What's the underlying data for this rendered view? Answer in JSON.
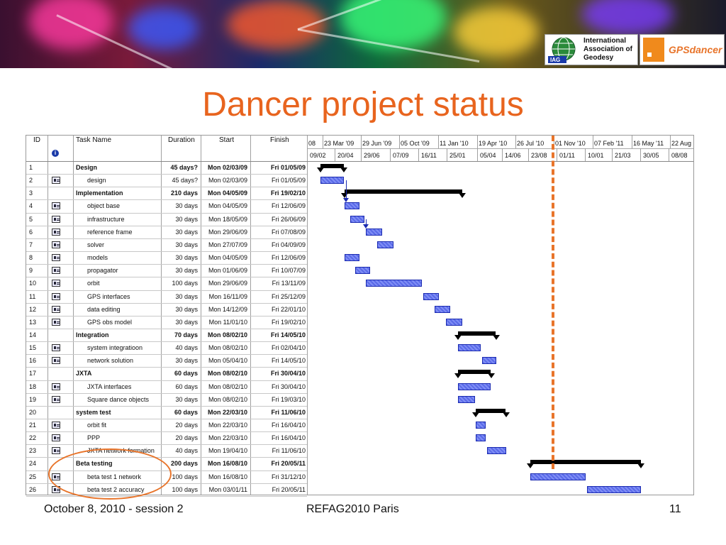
{
  "banner": {
    "iag_logo_text": "International Association of Geodesy",
    "iag_abbr": "IAG",
    "gps_logo_text": "GPSdancer"
  },
  "title": "Dancer project status",
  "gantt": {
    "headers": {
      "id": "ID",
      "task": "Task Name",
      "duration": "Duration",
      "start": "Start",
      "finish": "Finish"
    },
    "timescale_top": [
      "08",
      "23 Mar '09",
      "29 Jun '09",
      "05 Oct '09",
      "11 Jan '10",
      "19 Apr '10",
      "26 Jul '10",
      "01 Nov '10",
      "07 Feb '11",
      "16 May '11",
      "22 Aug"
    ],
    "timescale_bottom": [
      "09/02",
      "20/04",
      "29/06",
      "07/09",
      "16/11",
      "25/01",
      "05/04",
      "14/06",
      "23/08",
      "01/11",
      "10/01",
      "21/03",
      "30/05",
      "08/08"
    ],
    "tasks": [
      {
        "id": "1",
        "name": "Design",
        "duration": "45 days?",
        "start": "Mon 02/03/09",
        "finish": "Fri 01/05/09",
        "summary": true,
        "indent": 0
      },
      {
        "id": "2",
        "name": "design",
        "duration": "45 days?",
        "start": "Mon 02/03/09",
        "finish": "Fri 01/05/09",
        "summary": false,
        "indent": 1
      },
      {
        "id": "3",
        "name": "Implementation",
        "duration": "210 days",
        "start": "Mon 04/05/09",
        "finish": "Fri 19/02/10",
        "summary": true,
        "indent": 0
      },
      {
        "id": "4",
        "name": "object base",
        "duration": "30 days",
        "start": "Mon 04/05/09",
        "finish": "Fri 12/06/09",
        "summary": false,
        "indent": 1
      },
      {
        "id": "5",
        "name": "infrastructure",
        "duration": "30 days",
        "start": "Mon 18/05/09",
        "finish": "Fri 26/06/09",
        "summary": false,
        "indent": 1
      },
      {
        "id": "6",
        "name": "reference frame",
        "duration": "30 days",
        "start": "Mon 29/06/09",
        "finish": "Fri 07/08/09",
        "summary": false,
        "indent": 1
      },
      {
        "id": "7",
        "name": "solver",
        "duration": "30 days",
        "start": "Mon 27/07/09",
        "finish": "Fri 04/09/09",
        "summary": false,
        "indent": 1
      },
      {
        "id": "8",
        "name": "models",
        "duration": "30 days",
        "start": "Mon 04/05/09",
        "finish": "Fri 12/06/09",
        "summary": false,
        "indent": 1
      },
      {
        "id": "9",
        "name": "propagator",
        "duration": "30 days",
        "start": "Mon 01/06/09",
        "finish": "Fri 10/07/09",
        "summary": false,
        "indent": 1
      },
      {
        "id": "10",
        "name": "orbit",
        "duration": "100 days",
        "start": "Mon 29/06/09",
        "finish": "Fri 13/11/09",
        "summary": false,
        "indent": 1
      },
      {
        "id": "11",
        "name": "GPS interfaces",
        "duration": "30 days",
        "start": "Mon 16/11/09",
        "finish": "Fri 25/12/09",
        "summary": false,
        "indent": 1
      },
      {
        "id": "12",
        "name": "data editing",
        "duration": "30 days",
        "start": "Mon 14/12/09",
        "finish": "Fri 22/01/10",
        "summary": false,
        "indent": 1
      },
      {
        "id": "13",
        "name": "GPS obs model",
        "duration": "30 days",
        "start": "Mon 11/01/10",
        "finish": "Fri 19/02/10",
        "summary": false,
        "indent": 1
      },
      {
        "id": "14",
        "name": "Integration",
        "duration": "70 days",
        "start": "Mon 08/02/10",
        "finish": "Fri 14/05/10",
        "summary": true,
        "indent": 0
      },
      {
        "id": "15",
        "name": "system integratioon",
        "duration": "40 days",
        "start": "Mon 08/02/10",
        "finish": "Fri 02/04/10",
        "summary": false,
        "indent": 1
      },
      {
        "id": "16",
        "name": "network solution",
        "duration": "30 days",
        "start": "Mon 05/04/10",
        "finish": "Fri 14/05/10",
        "summary": false,
        "indent": 1
      },
      {
        "id": "17",
        "name": "JXTA",
        "duration": "60 days",
        "start": "Mon 08/02/10",
        "finish": "Fri 30/04/10",
        "summary": true,
        "indent": 0
      },
      {
        "id": "18",
        "name": "JXTA interfaces",
        "duration": "60 days",
        "start": "Mon 08/02/10",
        "finish": "Fri 30/04/10",
        "summary": false,
        "indent": 1
      },
      {
        "id": "19",
        "name": "Square dance objects",
        "duration": "30 days",
        "start": "Mon 08/02/10",
        "finish": "Fri 19/03/10",
        "summary": false,
        "indent": 1
      },
      {
        "id": "20",
        "name": "system test",
        "duration": "60 days",
        "start": "Mon 22/03/10",
        "finish": "Fri 11/06/10",
        "summary": true,
        "indent": 0
      },
      {
        "id": "21",
        "name": "orbit fit",
        "duration": "20 days",
        "start": "Mon 22/03/10",
        "finish": "Fri 16/04/10",
        "summary": false,
        "indent": 1
      },
      {
        "id": "22",
        "name": "PPP",
        "duration": "20 days",
        "start": "Mon 22/03/10",
        "finish": "Fri 16/04/10",
        "summary": false,
        "indent": 1
      },
      {
        "id": "23",
        "name": "JXTA network formation",
        "duration": "40 days",
        "start": "Mon 19/04/10",
        "finish": "Fri 11/06/10",
        "summary": false,
        "indent": 1
      },
      {
        "id": "24",
        "name": "Beta testing",
        "duration": "200 days",
        "start": "Mon 16/08/10",
        "finish": "Fri 20/05/11",
        "summary": true,
        "indent": 0
      },
      {
        "id": "25",
        "name": "beta test 1 network",
        "duration": "100 days",
        "start": "Mon 16/08/10",
        "finish": "Fri 31/12/10",
        "summary": false,
        "indent": 1
      },
      {
        "id": "26",
        "name": "beta test 2 accuracy",
        "duration": "100 days",
        "start": "Mon 03/01/11",
        "finish": "Fri 20/05/11",
        "summary": false,
        "indent": 1
      }
    ]
  },
  "footer": {
    "left": "October 8, 2010 - session 2",
    "center": "REFAG2010 Paris",
    "right": "11"
  }
}
